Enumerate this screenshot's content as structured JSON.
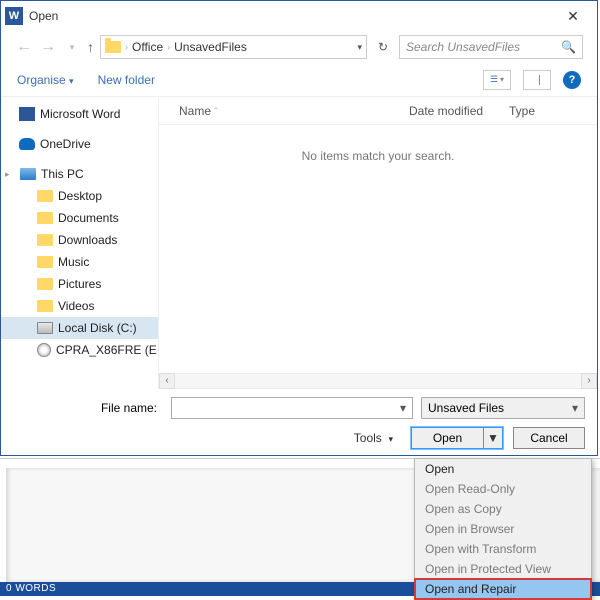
{
  "title": "Open",
  "nav": {
    "path": [
      "Office",
      "UnsavedFiles"
    ],
    "search_placeholder": "Search UnsavedFiles"
  },
  "toolbar": {
    "organise": "Organise",
    "newfolder": "New folder"
  },
  "tree": {
    "items": [
      {
        "label": "Microsoft Word",
        "icon": "word"
      },
      {
        "label": "OneDrive",
        "icon": "onedrive"
      },
      {
        "label": "This PC",
        "icon": "pc",
        "expandable": true
      },
      {
        "label": "Desktop",
        "icon": "folder",
        "indent": true
      },
      {
        "label": "Documents",
        "icon": "folder",
        "indent": true
      },
      {
        "label": "Downloads",
        "icon": "folder",
        "indent": true
      },
      {
        "label": "Music",
        "icon": "folder",
        "indent": true
      },
      {
        "label": "Pictures",
        "icon": "folder",
        "indent": true
      },
      {
        "label": "Videos",
        "icon": "folder",
        "indent": true
      },
      {
        "label": "Local Disk (C:)",
        "icon": "drive",
        "indent": true,
        "selected": true
      },
      {
        "label": "CPRA_X86FRE (E",
        "icon": "disc",
        "indent": true
      }
    ]
  },
  "list": {
    "columns": [
      "Name",
      "Date modified",
      "Type"
    ],
    "empty": "No items match your search."
  },
  "filebar": {
    "filename_label": "File name:",
    "filter": "Unsaved Files",
    "tools": "Tools",
    "open": "Open",
    "cancel": "Cancel"
  },
  "menu": {
    "items": [
      {
        "label": "Open",
        "enabled": true
      },
      {
        "label": "Open Read-Only",
        "enabled": false
      },
      {
        "label": "Open as Copy",
        "enabled": false
      },
      {
        "label": "Open in Browser",
        "enabled": false
      },
      {
        "label": "Open with Transform",
        "enabled": false
      },
      {
        "label": "Open in Protected View",
        "enabled": false
      },
      {
        "label": "Open and Repair",
        "enabled": true,
        "selected": true
      }
    ]
  },
  "status": {
    "words": "0 WORDS"
  }
}
